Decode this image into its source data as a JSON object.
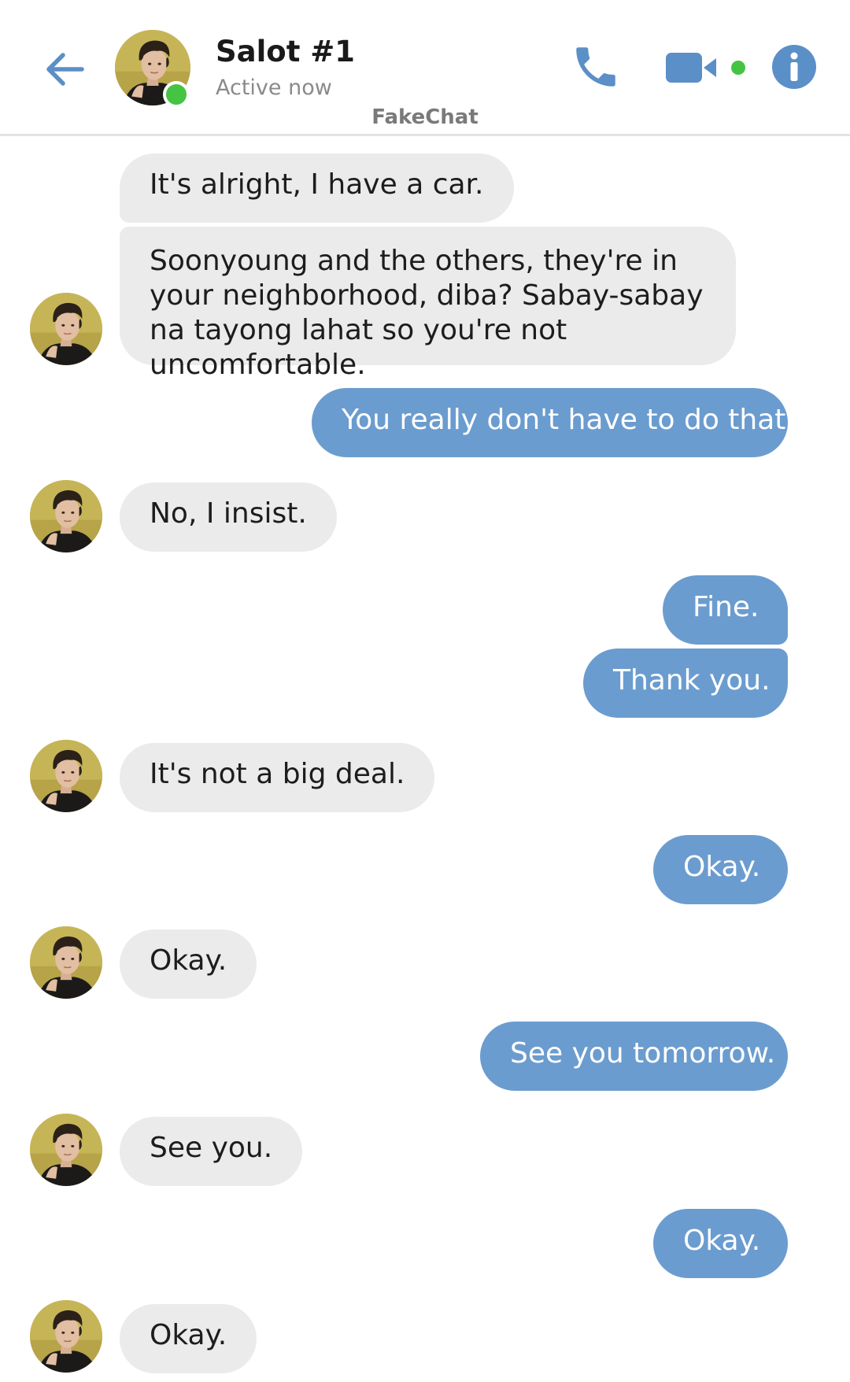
{
  "header": {
    "back_icon": "arrow-left-icon",
    "contact_name": "Salot #1",
    "status": "Active now",
    "app_name": "FakeChat",
    "actions": [
      {
        "icon": "phone-icon"
      },
      {
        "icon": "video-camera-icon"
      },
      {
        "icon": "info-icon"
      }
    ],
    "online_indicator_color": "#45c443"
  },
  "colors": {
    "accent": "#6b9ccf",
    "incoming_bubble": "#ebebeb",
    "incoming_text": "#1d1d1d",
    "outgoing_text": "#ffffff"
  },
  "messages": [
    {
      "side": "in",
      "text": "It's alright, I have a car."
    },
    {
      "side": "in",
      "text": "Soonyoung and the others, they're in your neighborhood, diba? Sabay-sabay na tayong lahat so you're not uncomfortable."
    },
    {
      "side": "out",
      "text": "You really don't have to do that."
    },
    {
      "side": "in",
      "text": "No, I insist."
    },
    {
      "side": "out",
      "text": "Fine."
    },
    {
      "side": "out",
      "text": "Thank you."
    },
    {
      "side": "in",
      "text": "It's not a big deal."
    },
    {
      "side": "out",
      "text": "Okay."
    },
    {
      "side": "in",
      "text": "Okay."
    },
    {
      "side": "out",
      "text": "See you tomorrow."
    },
    {
      "side": "in",
      "text": "See you."
    },
    {
      "side": "out",
      "text": "Okay."
    },
    {
      "side": "in",
      "text": "Okay."
    }
  ]
}
